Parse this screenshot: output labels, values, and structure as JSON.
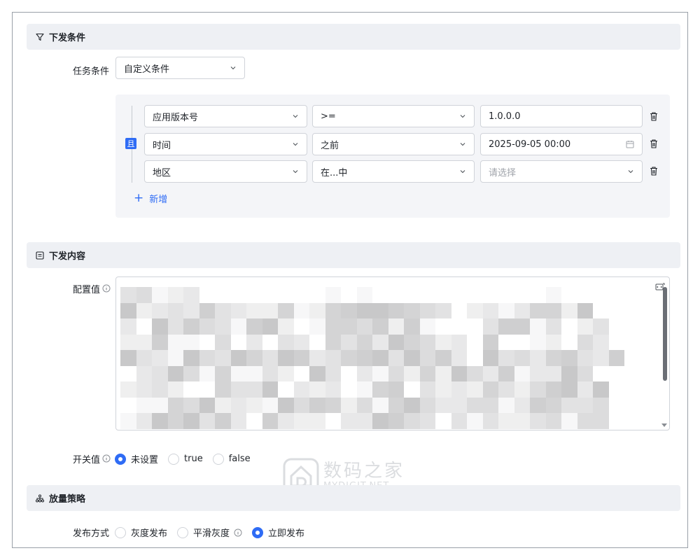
{
  "sections": {
    "conditions": {
      "title": "下发条件",
      "icon": "filter-icon"
    },
    "content": {
      "title": "下发内容",
      "icon": "document-icon"
    },
    "rollout": {
      "title": "放量策略",
      "icon": "hierarchy-icon"
    }
  },
  "task_condition": {
    "label": "任务条件",
    "value": "自定义条件"
  },
  "condition_group": {
    "logic_label": "且",
    "rows": [
      {
        "field": "应用版本号",
        "operator": ">=",
        "value": "1.0.0.0",
        "value_type": "text"
      },
      {
        "field": "时间",
        "operator": "之前",
        "value": "2025-09-05 00:00",
        "value_type": "date"
      },
      {
        "field": "地区",
        "operator": "在...中",
        "value": "",
        "placeholder": "请选择",
        "value_type": "select"
      }
    ],
    "add_label": "新增"
  },
  "config_value": {
    "label": "配置值"
  },
  "switch_value": {
    "label": "开关值",
    "options": [
      "未设置",
      "true",
      "false"
    ],
    "selected": "未设置"
  },
  "release": {
    "label": "发布方式",
    "options": [
      "灰度发布",
      "平滑灰度",
      "立即发布"
    ],
    "selected": "立即发布"
  },
  "watermark": {
    "cn": "数码之家",
    "en": "MYDIGIT.NET"
  },
  "colors": {
    "accent": "#2f6cf5",
    "section_bg": "#eef0f4",
    "group_bg": "#f4f5f8"
  }
}
